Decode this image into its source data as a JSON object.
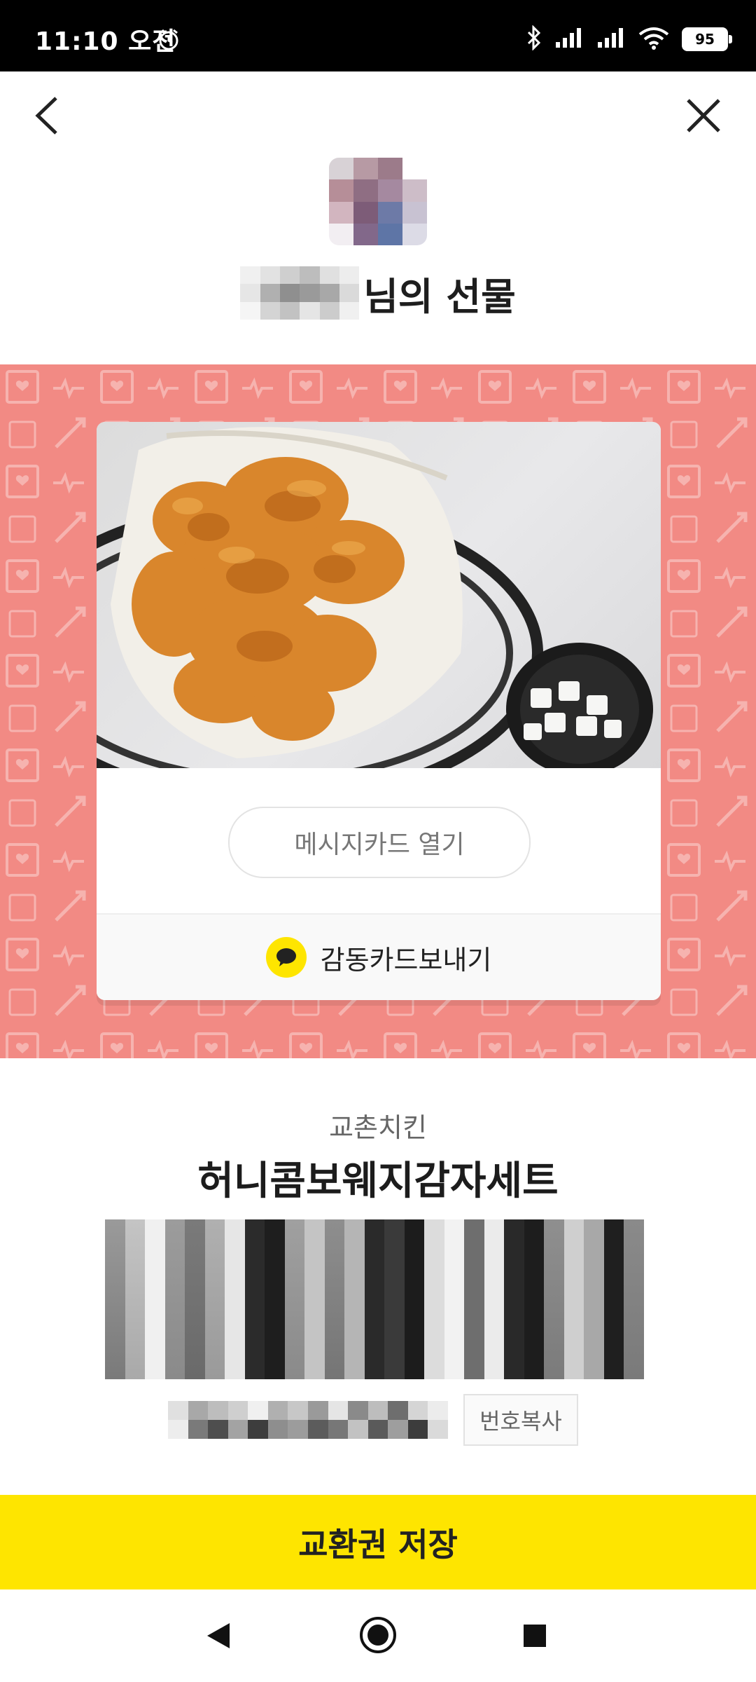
{
  "status_bar": {
    "time": "11:10 오전",
    "battery": "95"
  },
  "header": {
    "back_icon": "chevron-left-icon",
    "close_icon": "close-icon"
  },
  "sender": {
    "title_suffix": "님의 선물"
  },
  "gift_card": {
    "message_button": "메시지카드 열기",
    "send_card_label": "감동카드보내기",
    "band_color": "#f28a84"
  },
  "product": {
    "brand": "교촌치킨",
    "name": "허니콤보웨지감자세트",
    "copy_button": "번호복사"
  },
  "footer": {
    "save_button": "교환권 저장",
    "accent_color": "#fee500"
  },
  "nav": {
    "back": "nav-back-icon",
    "home": "nav-home-icon",
    "recent": "nav-recent-icon"
  }
}
